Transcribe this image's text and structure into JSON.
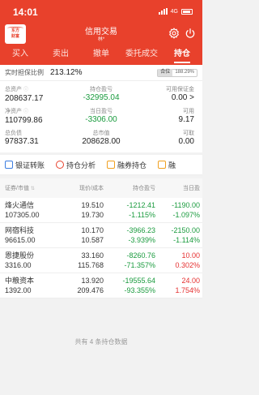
{
  "status_bar": {
    "time": "14:01",
    "network": "4G"
  },
  "header": {
    "logo_lines": [
      "东方",
      "财富"
    ],
    "title": "信用交易",
    "subtitle": "林*"
  },
  "tabs": [
    {
      "label": "买入",
      "active": false
    },
    {
      "label": "卖出",
      "active": false
    },
    {
      "label": "撤单",
      "active": false
    },
    {
      "label": "委托成交",
      "active": false
    },
    {
      "label": "持仓",
      "active": true
    }
  ],
  "summary": {
    "ratio_label": "实时担保比例",
    "ratio_value": "213.12%",
    "badge_label": "合位",
    "badge_value": "188.29%",
    "metrics": [
      {
        "label": "总资产",
        "value": "208637.17",
        "color": "normal",
        "has_icon": true
      },
      {
        "label": "持仓盈亏",
        "value": "-32995.04",
        "color": "green"
      },
      {
        "label": "可用保证金",
        "value": "0.00 >",
        "color": "normal"
      },
      {
        "label": "净资产",
        "value": "110799.86",
        "color": "normal",
        "has_icon": true
      },
      {
        "label": "当日盈亏",
        "value": "-3306.00",
        "color": "green"
      },
      {
        "label": "可用",
        "value": "9.17",
        "color": "normal"
      },
      {
        "label": "总负债",
        "value": "97837.31",
        "color": "normal"
      },
      {
        "label": "总市值",
        "value": "208628.00",
        "color": "normal"
      },
      {
        "label": "可取",
        "value": "0.00",
        "color": "normal"
      }
    ]
  },
  "quick_actions": [
    {
      "label": "银证转账",
      "icon": "transfer-icon",
      "color": "#3b7de0"
    },
    {
      "label": "持仓分析",
      "icon": "analysis-icon",
      "color": "#e8412c"
    },
    {
      "label": "融券持仓",
      "icon": "bag-icon",
      "color": "#f0a020"
    },
    {
      "label": "融",
      "icon": "more-icon",
      "color": "#f0a020"
    }
  ],
  "table": {
    "headers": [
      "证券/市值",
      "现价/成本",
      "持仓盈亏",
      "当日盈"
    ],
    "rows": [
      {
        "name": "烽火通信",
        "market_value": "107305.00",
        "price": "19.510",
        "cost": "19.730",
        "pl": "-1212.41",
        "pl_pct": "-1.115%",
        "day_pl": "-1190.00",
        "day_pct": "-1.097%",
        "pl_color": "green",
        "day_color": "green"
      },
      {
        "name": "网宿科技",
        "market_value": "96615.00",
        "price": "10.170",
        "cost": "10.587",
        "pl": "-3966.23",
        "pl_pct": "-3.939%",
        "day_pl": "-2150.00",
        "day_pct": "-1.114%",
        "pl_color": "green",
        "day_color": "green"
      },
      {
        "name": "恩捷股份",
        "market_value": "3316.00",
        "price": "33.160",
        "cost": "115.768",
        "pl": "-8260.76",
        "pl_pct": "-71.357%",
        "day_pl": "10.00",
        "day_pct": "0.302%",
        "pl_color": "green",
        "day_color": "red"
      },
      {
        "name": "中粮资本",
        "market_value": "1392.00",
        "price": "13.920",
        "cost": "209.476",
        "pl": "-19555.64",
        "pl_pct": "-93.355%",
        "day_pl": "24.00",
        "day_pct": "1.754%",
        "pl_color": "green",
        "day_color": "red"
      }
    ]
  },
  "footer_note": "共有 4 条持仓数据"
}
